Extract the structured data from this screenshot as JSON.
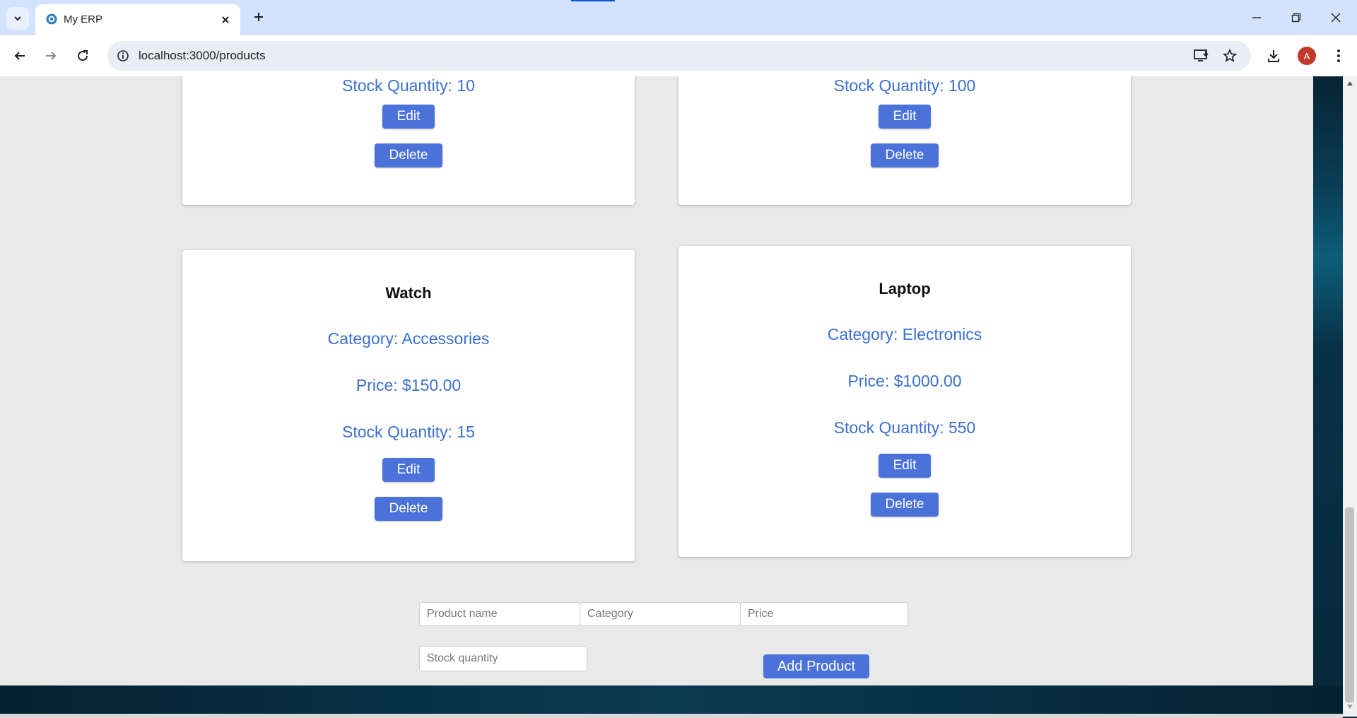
{
  "browser": {
    "tab_title": "My ERP",
    "url": "localhost:3000/products",
    "profile_initial": "A"
  },
  "products": [
    {
      "name": "",
      "category": "",
      "price": "",
      "stock": "Stock Quantity: 10",
      "edit_label": "Edit",
      "delete_label": "Delete"
    },
    {
      "name": "",
      "category": "",
      "price": "",
      "stock": "Stock Quantity: 100",
      "edit_label": "Edit",
      "delete_label": "Delete"
    },
    {
      "name": "Watch",
      "category": "Category: Accessories",
      "price": "Price: $150.00",
      "stock": "Stock Quantity: 15",
      "edit_label": "Edit",
      "delete_label": "Delete"
    },
    {
      "name": "Laptop",
      "category": "Category: Electronics",
      "price": "Price: $1000.00",
      "stock": "Stock Quantity: 550",
      "edit_label": "Edit",
      "delete_label": "Delete"
    }
  ],
  "form": {
    "name_placeholder": "Product name",
    "category_placeholder": "Category",
    "price_placeholder": "Price",
    "stock_placeholder": "Stock quantity",
    "add_label": "Add Product"
  },
  "colors": {
    "accent_button": "#4b72d9",
    "card_text": "#3a6fcf",
    "page_background": "#e9e9e9"
  }
}
